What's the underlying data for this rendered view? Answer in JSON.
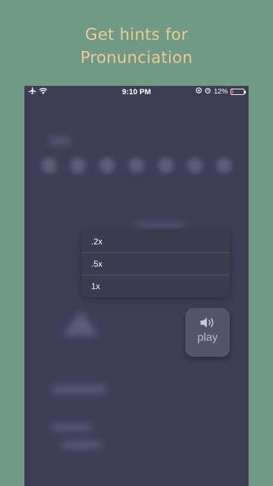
{
  "headline": {
    "line1": "Get hints for",
    "line2": "Pronunciation"
  },
  "status_bar": {
    "time": "9:10 PM",
    "battery_percent": "12%",
    "battery_level": 0.12
  },
  "speed_menu": {
    "items": [
      ".2x",
      ".5x",
      "1x"
    ]
  },
  "play_button": {
    "label": "play",
    "icon": "speaker-icon"
  },
  "colors": {
    "background": "#6f9a83",
    "headline": "#efc996",
    "phone": "#3f3d56",
    "menu": "#3c3a4d"
  }
}
